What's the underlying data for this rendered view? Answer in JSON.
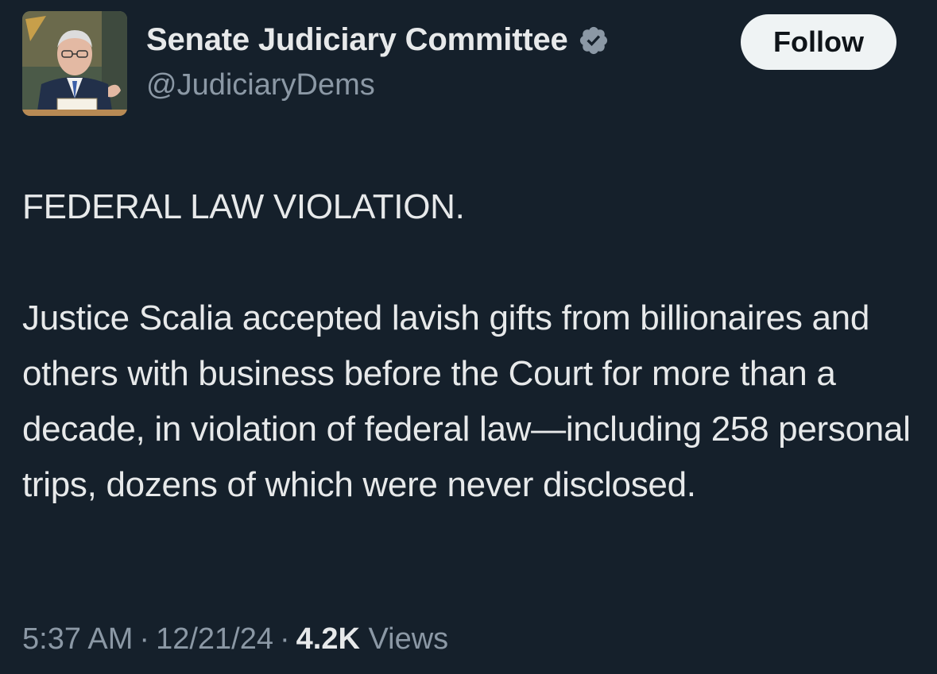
{
  "author": {
    "display_name": "Senate Judiciary Committee",
    "handle": "@JudiciaryDems",
    "verified": true,
    "verified_icon": "verified-badge-icon",
    "avatar": "avatar-photo"
  },
  "follow_label": "Follow",
  "tweet": {
    "lines": [
      "FEDERAL LAW VIOLATION.",
      "Justice Scalia accepted lavish gifts from billionaires and others with business before the Court for more than a decade, in violation of federal law—including 258 personal trips, dozens of which were never disclosed."
    ]
  },
  "meta": {
    "time": "5:37 AM",
    "separator": "·",
    "date": "12/21/24",
    "views_count": "4.2K",
    "views_label": "Views"
  },
  "colors": {
    "background": "#15202b",
    "text": "#e7e9ea",
    "secondary": "#8b98a5",
    "badge": "#8b98a5",
    "follow_bg": "#eff3f4"
  }
}
